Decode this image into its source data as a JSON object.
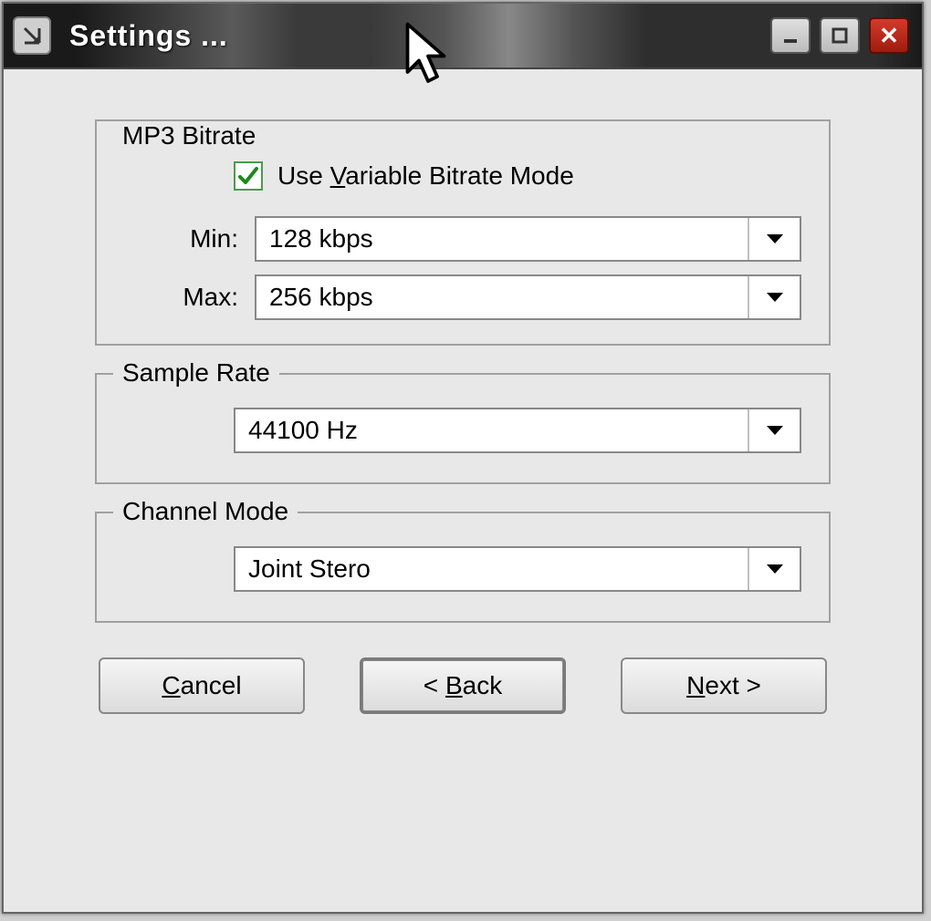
{
  "window": {
    "title": "Settings ..."
  },
  "mp3_bitrate": {
    "legend": "MP3 Bitrate",
    "vbr_label_prefix": "Use ",
    "vbr_label_ul": "V",
    "vbr_label_suffix": "ariable Bitrate Mode",
    "vbr_checked": true,
    "min_label": "Min:",
    "min_value": "128 kbps",
    "max_label": "Max:",
    "max_value": "256 kbps"
  },
  "sample_rate": {
    "legend": "Sample Rate",
    "value": "44100 Hz"
  },
  "channel_mode": {
    "legend": "Channel Mode",
    "value": "Joint Stero"
  },
  "buttons": {
    "cancel_ul": "C",
    "cancel_suffix": "ancel",
    "back_prefix": "< ",
    "back_ul": "B",
    "back_suffix": "ack",
    "next_ul": "N",
    "next_suffix": "ext >"
  }
}
